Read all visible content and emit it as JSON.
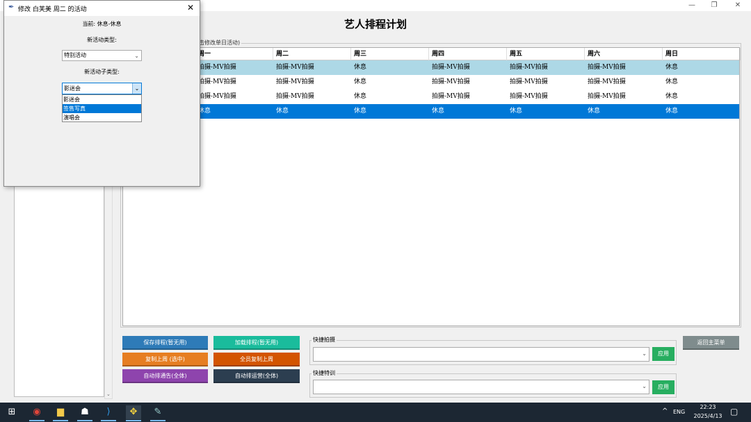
{
  "window": {
    "title": "艺人排程计划"
  },
  "schedule": {
    "frame_label": "击修改单日活动)",
    "columns": [
      "周一",
      "周二",
      "周三",
      "周四",
      "周五",
      "周六",
      "周日"
    ],
    "rows": [
      [
        "拍摄-MV拍摄",
        "拍摄-MV拍摄",
        "休息",
        "拍摄-MV拍摄",
        "拍摄-MV拍摄",
        "拍摄-MV拍摄",
        "休息"
      ],
      [
        "拍摄-MV拍摄",
        "拍摄-MV拍摄",
        "休息",
        "拍摄-MV拍摄",
        "拍摄-MV拍摄",
        "拍摄-MV拍摄",
        "休息"
      ],
      [
        "拍摄-MV拍摄",
        "拍摄-MV拍摄",
        "休息",
        "拍摄-MV拍摄",
        "拍摄-MV拍摄",
        "拍摄-MV拍摄",
        "休息"
      ],
      [
        "休息",
        "休息",
        "休息",
        "休息",
        "休息",
        "休息",
        "休息"
      ]
    ]
  },
  "buttons": {
    "save": "保存排程(暂无用)",
    "load": "加载排程(暂无用)",
    "copy_last": "复制上周 (选中)",
    "copy_all": "全员复制上周",
    "auto_ad": "自动排通告(全体)",
    "auto_ops": "自动排运营(全体)",
    "back": "返回主菜单"
  },
  "quick": {
    "shoot_label": "快捷拍摄",
    "train_label": "快捷特训",
    "apply": "应用",
    "shoot_value": "",
    "train_value": ""
  },
  "dialog": {
    "title": "修改 白芙美 周二 的活动",
    "current": "当前: 休息-休息",
    "type_label": "新活动类型:",
    "type_value": "特别活动",
    "subtype_label": "新活动子类型:",
    "subtype_value": "影迷会",
    "subtype_options": [
      "影迷会",
      "签售写真",
      "演唱会"
    ]
  },
  "taskbar": {
    "lang": "ENG",
    "time": "22:23",
    "date": "2025/4/13"
  },
  "colors": {
    "save": "#2e7bb8",
    "load": "#1abc9c",
    "copy_last": "#e67e22",
    "copy_all": "#d35400",
    "auto_ad": "#8e44ad",
    "auto_ops": "#2c3e50",
    "back": "#7f8c8d",
    "selected": "#0078d7",
    "highlight": "#add8e6"
  }
}
